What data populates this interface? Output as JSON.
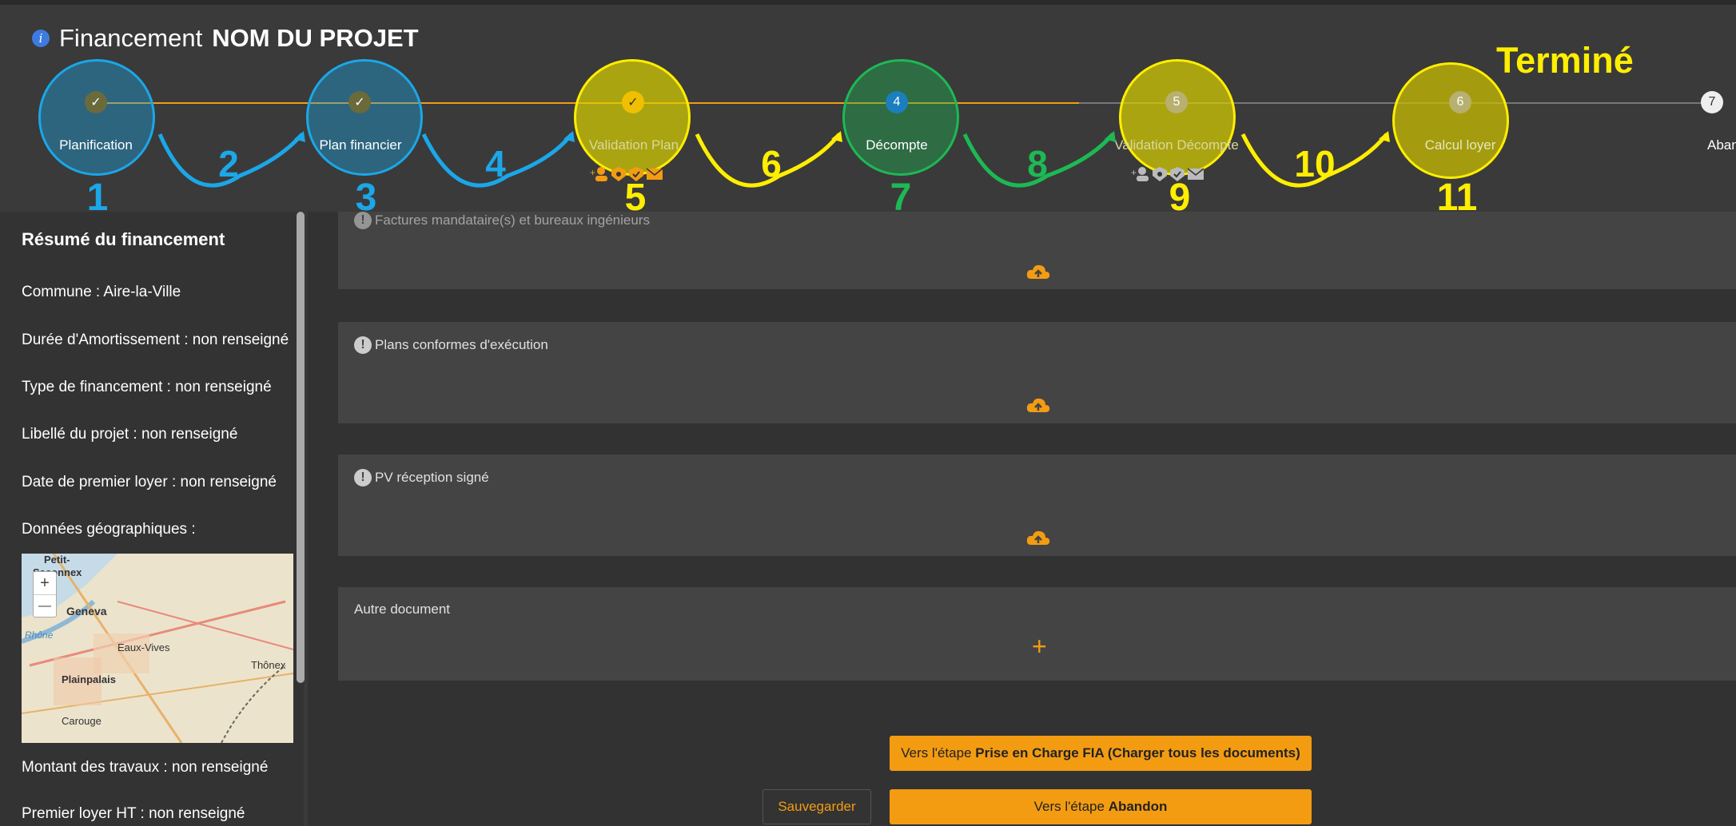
{
  "header": {
    "title_prefix": "Financement",
    "title_project": "NOM DU PROJET"
  },
  "stepper": {
    "status_label": "Terminé",
    "steps": [
      {
        "label": "Planification",
        "dot": "✓"
      },
      {
        "label": "Plan financier",
        "dot": "✓"
      },
      {
        "label": "Validation Plan",
        "dot": "✓"
      },
      {
        "label": "Décompte",
        "dot": "4"
      },
      {
        "label": "Validation Décompte",
        "dot": "5"
      },
      {
        "label": "Calcul loyer",
        "dot": "6"
      },
      {
        "label": "Abandon",
        "dot": "7"
      }
    ],
    "annotations": [
      "1",
      "2",
      "3",
      "4",
      "5",
      "6",
      "7",
      "8",
      "9",
      "10",
      "11"
    ]
  },
  "sidebar": {
    "title": "Résumé du financement",
    "items": [
      "Commune : Aire-la-Ville",
      "Durée d'Amortissement : non renseigné",
      "Type de financement : non renseigné",
      "Libellé du projet : non renseigné",
      "Date de premier loyer : non renseigné",
      "Données géographiques :",
      "Montant des travaux : non renseigné",
      "Premier loyer HT : non renseigné"
    ],
    "map_labels": [
      "Petit-",
      "Saconnex",
      "Geneva",
      "Eaux-Vives",
      "Plainpalais",
      "Thônex",
      "Carouge",
      "Rhône"
    ],
    "map_zoom_in": "+",
    "map_zoom_out": "—"
  },
  "documents": [
    {
      "label": "Factures mandataire(s) et bureaux ingénieurs"
    },
    {
      "label": "Plans conformes d'exécution"
    },
    {
      "label": "PV réception signé"
    },
    {
      "label": "Autre document"
    }
  ],
  "actions": {
    "next_prefix": "Vers l'étape ",
    "next_bold": "Prise en Charge FIA (Charger tous les documents)",
    "abandon_prefix": "Vers l'étape ",
    "abandon_bold": "Abandon",
    "save_label": "Sauvegarder",
    "add_symbol": "+"
  },
  "colors": {
    "blue": "#1ba7e8",
    "yellow": "#ffee00",
    "green": "#1db954",
    "orange": "#f39c12"
  }
}
